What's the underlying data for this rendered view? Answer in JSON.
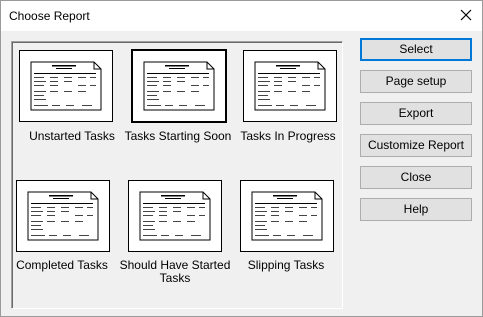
{
  "window": {
    "title": "Choose Report",
    "close_icon": "close-icon"
  },
  "reports": [
    {
      "label": "Unstarted Tasks",
      "icon": "report-thumbnail-icon",
      "selected": false
    },
    {
      "label": "Tasks Starting Soon",
      "icon": "report-thumbnail-icon",
      "selected": true
    },
    {
      "label": "Tasks In Progress",
      "icon": "report-thumbnail-icon",
      "selected": false
    },
    {
      "label": "Completed Tasks",
      "icon": "report-thumbnail-icon",
      "selected": false
    },
    {
      "label": "Should Have Started Tasks",
      "icon": "report-thumbnail-icon",
      "selected": false
    },
    {
      "label": "Slipping Tasks",
      "icon": "report-thumbnail-icon",
      "selected": false
    }
  ],
  "buttons": {
    "select": "Select",
    "page_setup": "Page setup",
    "export": "Export",
    "customize_report": "Customize Report",
    "close": "Close",
    "help": "Help"
  },
  "colors": {
    "window_bg": "#f0f0f0",
    "titlebar_bg": "#ffffff",
    "button_bg": "#e1e1e1",
    "button_border": "#adadad",
    "default_button_border": "#0078d7"
  }
}
